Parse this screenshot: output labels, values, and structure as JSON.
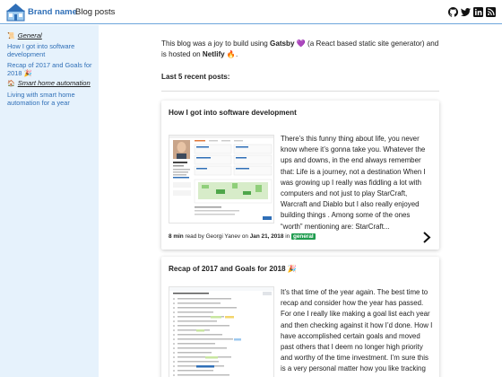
{
  "header": {
    "brand": "Brand name",
    "nav_blog": "Blog posts",
    "logo_icon": "house-logo-icon",
    "social_icons": [
      "github-icon",
      "twitter-icon",
      "linkedin-icon",
      "rss-icon"
    ]
  },
  "sidebar": {
    "categories": [
      {
        "label": "General",
        "emoji": "📜",
        "posts": [
          "How I got into software development",
          "Recap of 2017 and Goals for 2018 🎉"
        ]
      },
      {
        "label": "Smart home automation",
        "emoji": "🏠",
        "posts": [
          "Living with smart home automation for a year"
        ]
      }
    ]
  },
  "intro": {
    "prefix": "This blog was a joy to build using ",
    "gatsby": "Gatsby",
    "middle": " 💜 (a React based static site generator) and is hosted on ",
    "netlify": "Netlify",
    "suffix": " 🔥."
  },
  "recent_heading": "Last 5 recent posts:",
  "posts": [
    {
      "title": "How I got into software development",
      "excerpt": "There’s this funny thing about life, you never know where it’s gonna take you. Whatever the ups and downs, in the end always remember that: Life is a journey, not a destination When I was growing up I really was fiddling a lot with computers and not just to play StarCraft, Warcraft and Diablo but I also really enjoyed building things . Among some of the ones “worth” mentioning are: StarCraft...",
      "read_time": "8 min",
      "read_by": " read by ",
      "author": "Georgi Yanev",
      "on": " on ",
      "date": "Jan 21, 2018",
      "in": " in ",
      "tag": "general"
    },
    {
      "title": "Recap of 2017 and Goals for 2018 🎉",
      "excerpt": "It’s that time of the year again. The best time to recap and consider how the year has passed. For one I really like making a goal list each year and then checking against it how I’d done. How I have accomplished certain goals and moved past others that I deem no longer high priority and worthy of the time investment. I’m sure this is a very personal matter how you like tracking (or not..."
    }
  ],
  "colors": {
    "brand": "#2f6fb7",
    "sidebar_bg": "#e6f2fc",
    "tag_bg": "#1f9c4f",
    "header_border": "#6ea6dc"
  }
}
